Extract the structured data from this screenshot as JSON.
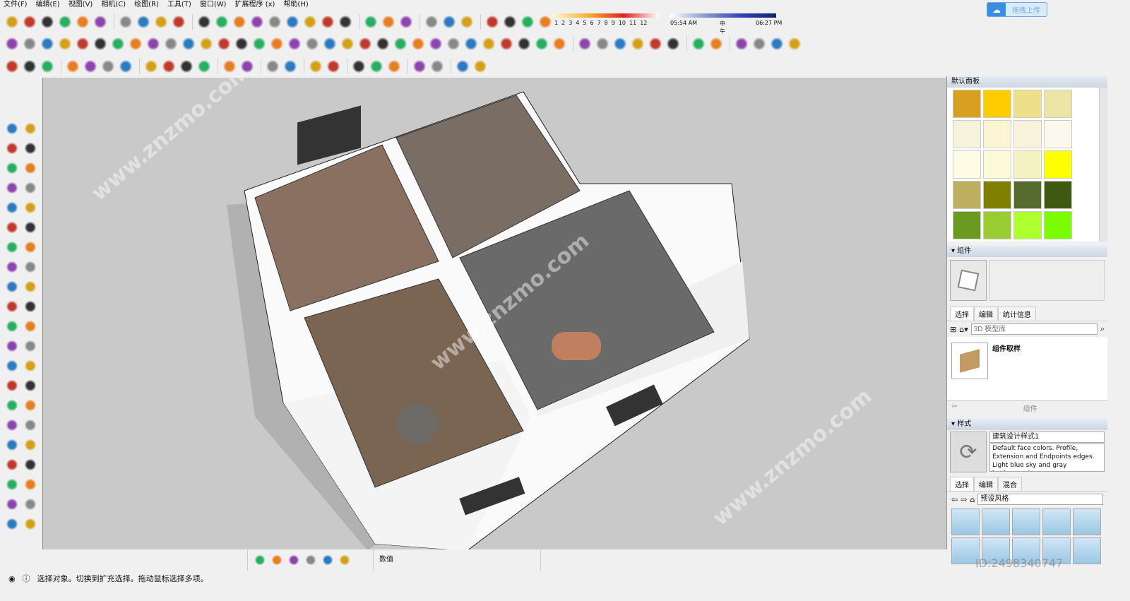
{
  "menu": [
    "文件(F)",
    "编辑(E)",
    "视图(V)",
    "相机(C)",
    "绘图(R)",
    "工具(T)",
    "窗口(W)",
    "扩展程序 (x)",
    "帮助(H)"
  ],
  "upload_button": "拖拽上传",
  "shadow": {
    "months": [
      "1",
      "2",
      "3",
      "4",
      "5",
      "6",
      "7",
      "8",
      "9",
      "10",
      "11",
      "12"
    ],
    "month_level": 9,
    "time_start": "05:54 AM",
    "time_mid": "中午",
    "time_end": "06:27 PM"
  },
  "tray": {
    "materials_title": "默认面板",
    "swatches": [
      "#d9a020",
      "#ffcc00",
      "#eee08a",
      "#ece6a6",
      "#f6f3dc",
      "#fbf5d4",
      "#f7f3da",
      "#fbf9ee",
      "#fdfde6",
      "#fcfad6",
      "#f3f3c2",
      "#ffff00",
      "#bdb060",
      "#7f7f00",
      "#556b2f",
      "#3d5a10",
      "#6b9a20",
      "#9acd32",
      "#adff2f",
      "#7cfc00",
      "#00ee00",
      "#ffffff",
      "#ffffff",
      "#ffffff"
    ],
    "components": {
      "title": "组件",
      "tabs": [
        "选择",
        "编辑",
        "统计信息"
      ],
      "search_placeholder": "3D 模型库",
      "item": "组件取样",
      "footer": "组件"
    },
    "styles": {
      "title": "样式",
      "name": "建筑设计样式1",
      "description": "Default face colors. Profile, Extension and Endpoints edges. Light blue sky and gray background.",
      "tabs": [
        "选择",
        "编辑",
        "混合"
      ],
      "collection": "预设风格"
    }
  },
  "measurements_label": "数值",
  "status": "选择对象。切换到扩充选择。拖动鼠标选择多项。",
  "watermark": "www.znzmo.com",
  "watermark_id": "ID:2498340747"
}
